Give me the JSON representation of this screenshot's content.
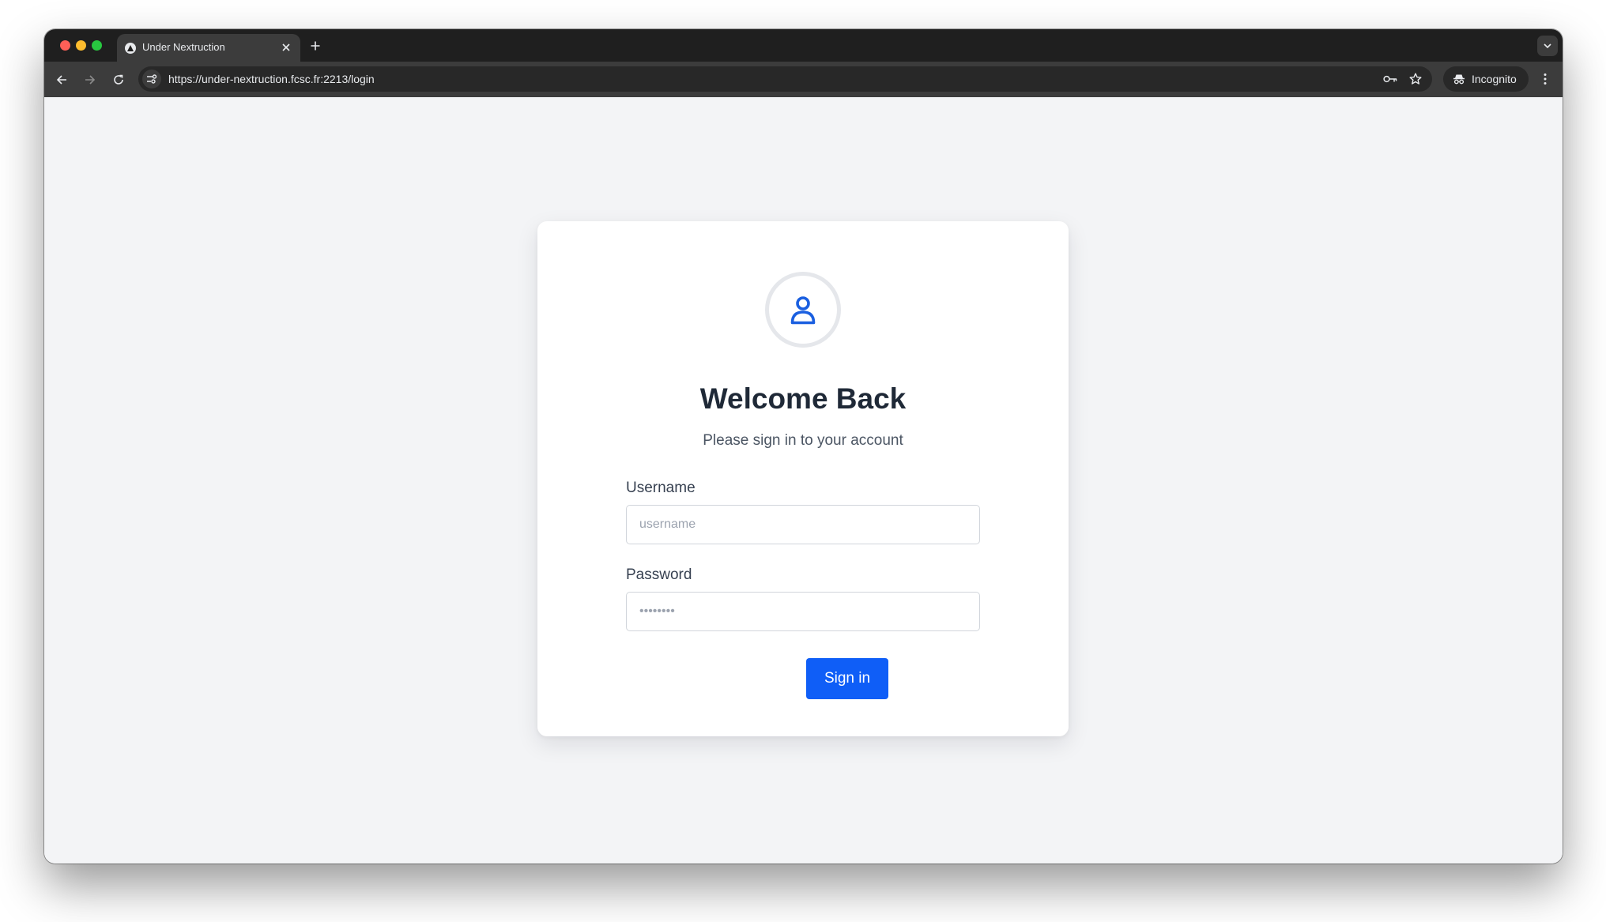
{
  "browser": {
    "tab": {
      "title": "Under Nextruction"
    },
    "address_bar": {
      "url": "https://under-nextruction.fcsc.fr:2213/login"
    },
    "incognito_label": "Incognito"
  },
  "login": {
    "title": "Welcome Back",
    "subtitle": "Please sign in to your account",
    "username": {
      "label": "Username",
      "placeholder": "username",
      "value": ""
    },
    "password": {
      "label": "Password",
      "placeholder": "••••••••",
      "value": ""
    },
    "submit_label": "Sign in"
  },
  "colors": {
    "accent": "#0f5ef7",
    "page_background": "#f3f4f6",
    "card_background": "#ffffff",
    "heading_text": "#1f2937"
  },
  "icons": {
    "avatar": "user-icon",
    "tab_favicon": "triangle-icon",
    "incognito": "incognito-icon"
  }
}
